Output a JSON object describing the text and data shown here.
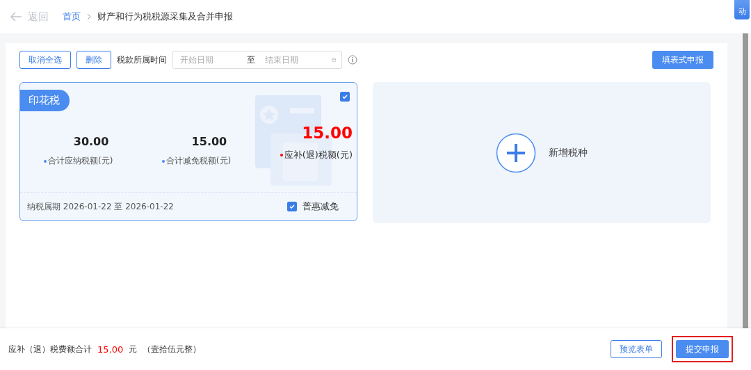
{
  "header": {
    "back": "返回",
    "breadcrumb": [
      {
        "label": "首页",
        "link": true
      },
      {
        "label": "财产和行为税税源采集及合并申报",
        "link": false
      }
    ],
    "side_tab": "动"
  },
  "toolbar": {
    "buttons": [
      "取消全选",
      "删除"
    ],
    "period_label": "税款所属时间",
    "start": {
      "placeholder": "开始日期"
    },
    "separator": "至",
    "end": {
      "placeholder": "结束日期"
    },
    "fill_button": "填表式申报"
  },
  "tax_cards": [
    {
      "name": "印花税",
      "checked": true,
      "amounts": [
        {
          "value": "30.00",
          "label": "合计应纳税额(元)",
          "kind": "normal"
        },
        {
          "value": "15.00",
          "label": "合计减免税额(元)",
          "kind": "normal"
        },
        {
          "value": "15.00",
          "label": "应补(退)税额(元)",
          "kind": "due"
        }
      ],
      "period": "纳税属期 2026-01-22 至 2026-01-22",
      "relief": {
        "label": "普惠减免",
        "checked": true
      }
    }
  ],
  "add_card": {
    "label": "新增税种"
  },
  "footer": {
    "label": "应补（退）税费额合计",
    "amount": "15.00",
    "unit": "元",
    "words": "（壹拾伍元整）",
    "buttons": [
      {
        "label": "预览表单",
        "kind": "secondary",
        "highlighted": false
      },
      {
        "label": "提交申报",
        "kind": "primary",
        "highlighted": true
      }
    ]
  }
}
